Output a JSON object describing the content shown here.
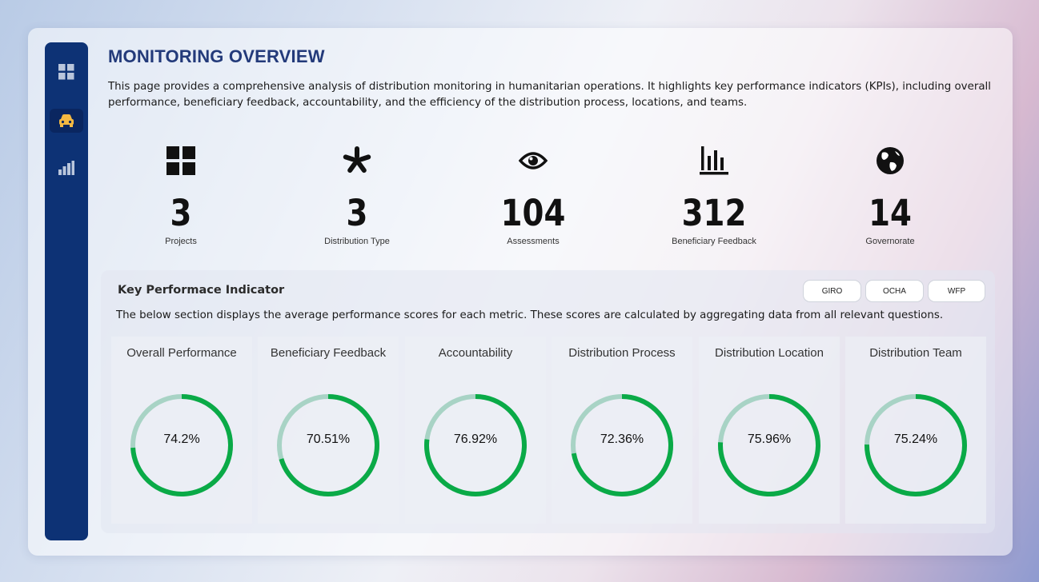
{
  "page_title": "MONITORING OVERVIEW",
  "description": "This page provides a comprehensive analysis of distribution monitoring in humanitarian operations. It highlights key performance indicators (KPIs), including overall performance, beneficiary feedback, accountability, and the efficiency of the distribution process, locations, and teams.",
  "sidebar": {
    "items": [
      {
        "icon": "dashboard-grid-icon",
        "active": false
      },
      {
        "icon": "car-icon",
        "active": true
      },
      {
        "icon": "bar-chart-icon",
        "active": false
      }
    ]
  },
  "kpis": [
    {
      "icon": "grid-icon",
      "value": "3",
      "label": "Projects"
    },
    {
      "icon": "asterisk-icon",
      "value": "3",
      "label": "Distribution Type"
    },
    {
      "icon": "eye-icon",
      "value": "104",
      "label": "Assessments"
    },
    {
      "icon": "bar-chart-icon",
      "value": "312",
      "label": "Beneficiary Feedback"
    },
    {
      "icon": "globe-icon",
      "value": "14",
      "label": "Governorate"
    }
  ],
  "kpi_section": {
    "title": "Key Performace Indicator",
    "description": "The below section displays the average performance scores for each metric. These scores are calculated by aggregating data from all relevant questions.",
    "filters": [
      "GIRO",
      "OCHA",
      "WFP"
    ]
  },
  "metrics": [
    {
      "title": "Overall Performance",
      "value": 74.2,
      "label": "74.2%"
    },
    {
      "title": "Beneficiary Feedback",
      "value": 70.51,
      "label": "70.51%"
    },
    {
      "title": "Accountability",
      "value": 76.92,
      "label": "76.92%"
    },
    {
      "title": "Distribution Process",
      "value": 72.36,
      "label": "72.36%"
    },
    {
      "title": "Distribution Location",
      "value": 75.96,
      "label": "75.96%"
    },
    {
      "title": "Distribution Team",
      "value": 75.24,
      "label": "75.24%"
    }
  ],
  "colors": {
    "accent": "#0aaa47",
    "track": "#a8d3c5",
    "sidebar": "#0d3275",
    "title": "#233a7a",
    "nav_active_icon": "#f5b942"
  }
}
